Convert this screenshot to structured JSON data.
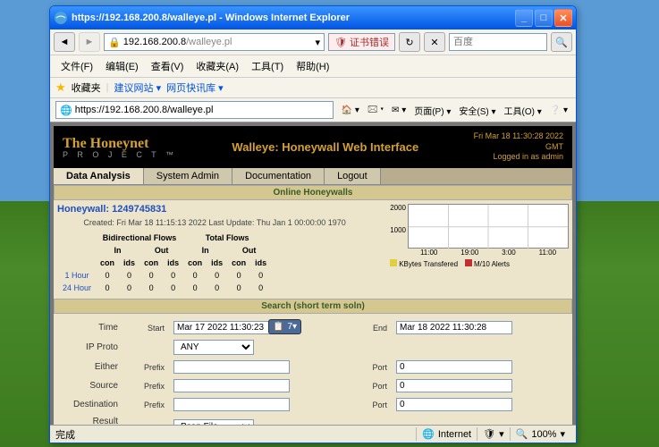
{
  "titlebar": {
    "url": "https://192.168.200.8/walleye.pl",
    "app": "Windows Internet Explorer"
  },
  "address": {
    "url": "192.168.200.8",
    "cert_alert": "证书错误",
    "search_placeholder": "百度",
    "full_url": "https://192.168.200.8/walleye.pl"
  },
  "menubar": [
    "文件(F)",
    "编辑(E)",
    "查看(V)",
    "收藏夹(A)",
    "工具(T)",
    "帮助(H)"
  ],
  "favbar": {
    "label": "收藏夹",
    "links": [
      "建议网站 ▾",
      "网页快讯库 ▾"
    ]
  },
  "toolbar2": [
    "🏠 ▾",
    "🖂 ▾",
    "✉ ▾",
    "页面(P) ▾",
    "安全(S) ▾",
    "工具(O) ▾",
    "❔ ▾"
  ],
  "banner": {
    "logo1": "The Honeynet",
    "logo2": "P R O J E C T ™",
    "title": "Walleye: Honeywall Web Interface",
    "time": "Fri Mar 18 11:30:28 2022",
    "tz": "GMT",
    "login": "Logged in as admin"
  },
  "tabs": [
    "Data Analysis",
    "System Admin",
    "Documentation",
    "Logout"
  ],
  "section1": {
    "header": "Online Honeywalls",
    "hw": "Honeywall: 1249745831",
    "created": "Created: Fri Mar 18 11:15:13 2022 Last Update: Thu Jan 1 00:00:00 1970",
    "bidi": "Bidirectional Flows",
    "total": "Total Flows",
    "in": "In",
    "out": "Out",
    "con": "con",
    "ids": "ids",
    "rows": [
      "1 Hour",
      "24 Hour"
    ],
    "chart_y": [
      "2000",
      "1000"
    ],
    "chart_x": [
      "11:00",
      "19:00",
      "3:00",
      "11:00"
    ],
    "legend1": "KBytes Transfered",
    "legend2": "M/10 Alerts"
  },
  "section2": {
    "header": "Search (short term soln)",
    "labels": {
      "time": "Time",
      "start": "Start",
      "end": "End",
      "ipproto": "IP Proto",
      "either": "Either",
      "source": "Source",
      "destination": "Destination",
      "result": "Result Format",
      "prefix": "Prefix",
      "port": "Port"
    },
    "values": {
      "start": "Mar 17 2022 11:30:23",
      "end": "Mar 18 2022 11:30:28",
      "proto": "ANY",
      "port1": "0",
      "port2": "0",
      "port3": "0",
      "result": "Pcap File"
    }
  },
  "autocomplete": "7▾",
  "statusbar": {
    "done": "完成",
    "internet": "Internet",
    "zoom": "100%"
  }
}
